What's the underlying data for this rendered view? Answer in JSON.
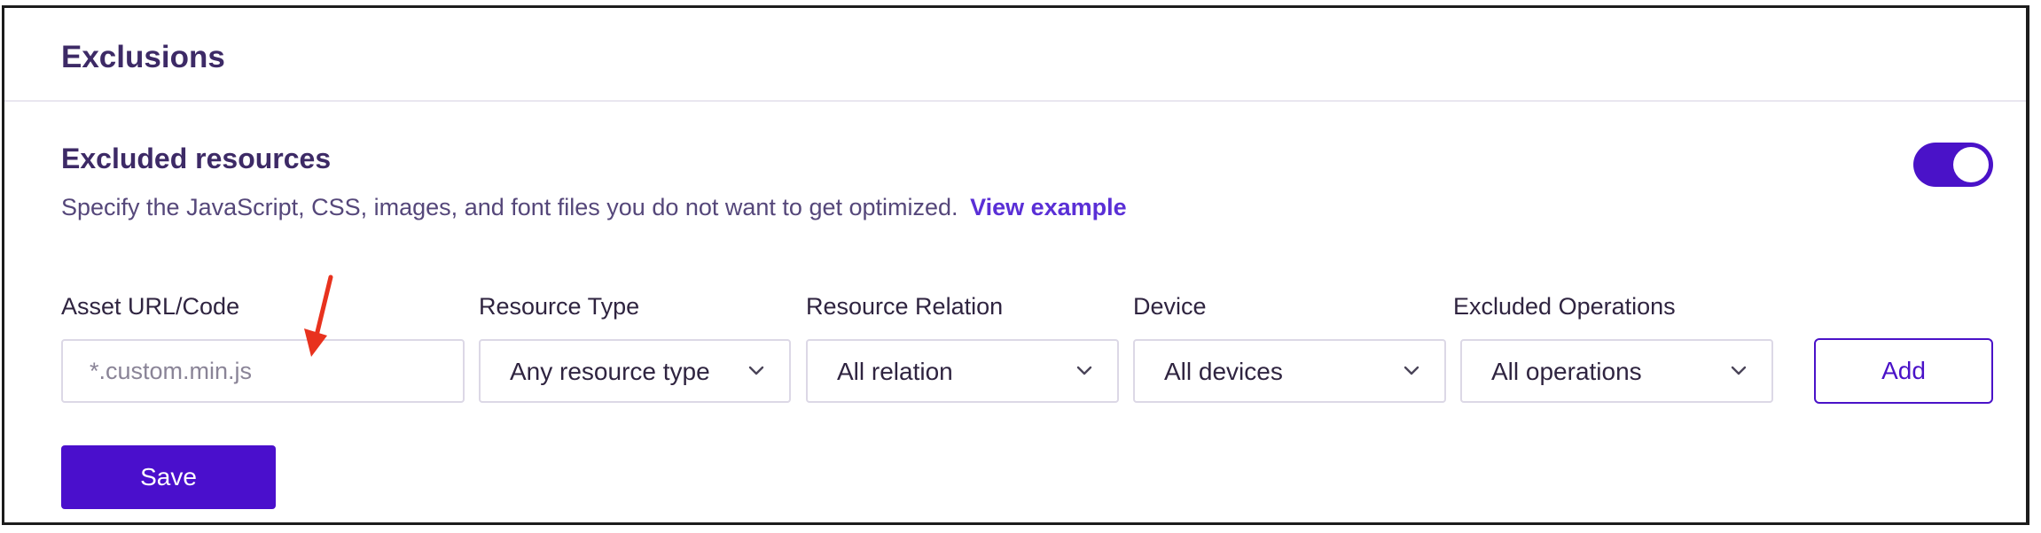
{
  "card": {
    "title": "Exclusions"
  },
  "section": {
    "title": "Excluded resources",
    "description": "Specify the JavaScript, CSS, images, and font files you do not want to get optimized.",
    "link_label": "View example",
    "toggle_on": true
  },
  "form": {
    "asset": {
      "label": "Asset URL/Code",
      "placeholder": "*.custom.min.js",
      "value": ""
    },
    "resource_type": {
      "label": "Resource Type",
      "value": "Any resource type"
    },
    "resource_relation": {
      "label": "Resource Relation",
      "value": "All relation"
    },
    "device": {
      "label": "Device",
      "value": "All devices"
    },
    "excluded_operations": {
      "label": "Excluded Operations",
      "value": "All operations"
    },
    "add_label": "Add",
    "save_label": "Save"
  },
  "colors": {
    "accent": "#4a12c8",
    "title": "#3d2a66",
    "annotation_arrow": "#e8321e"
  },
  "icons": {
    "dropdown": "chevron-down-icon",
    "annotation": "red-arrow-icon"
  }
}
